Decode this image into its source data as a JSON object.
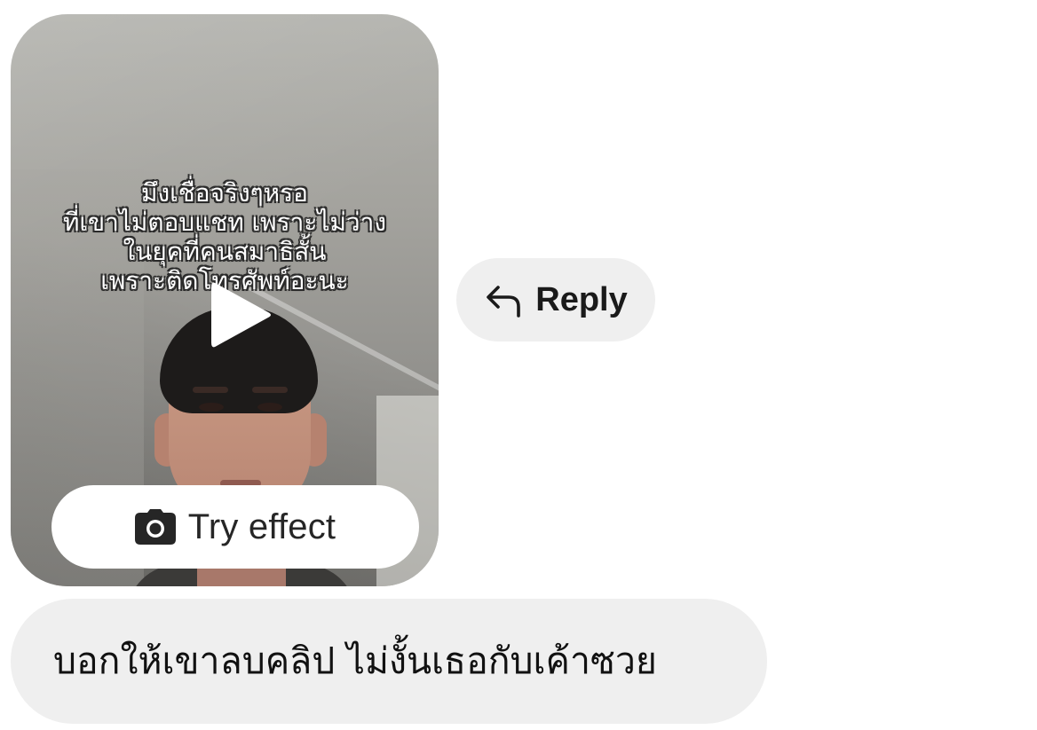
{
  "video_message": {
    "caption_lines": [
      "มึงเชื่อจริงๆหรอ",
      "ที่เขาไม่ตอบแชท เพราะไม่ว่าง",
      "ในยุคที่คนสมาธิสั้น",
      "เพราะติดโทรศัพท์อะนะ"
    ],
    "play_icon": "play-icon",
    "try_effect": {
      "icon": "camera-icon",
      "label": "Try effect"
    }
  },
  "reply": {
    "icon": "reply-arrow-icon",
    "label": "Reply"
  },
  "message": {
    "text": "บอกให้เขาลบคลิป ไม่งั้นเธอกับเค้าซวย"
  },
  "colors": {
    "bubble_background": "#efefef",
    "page_background": "#ffffff",
    "text": "#111111"
  }
}
